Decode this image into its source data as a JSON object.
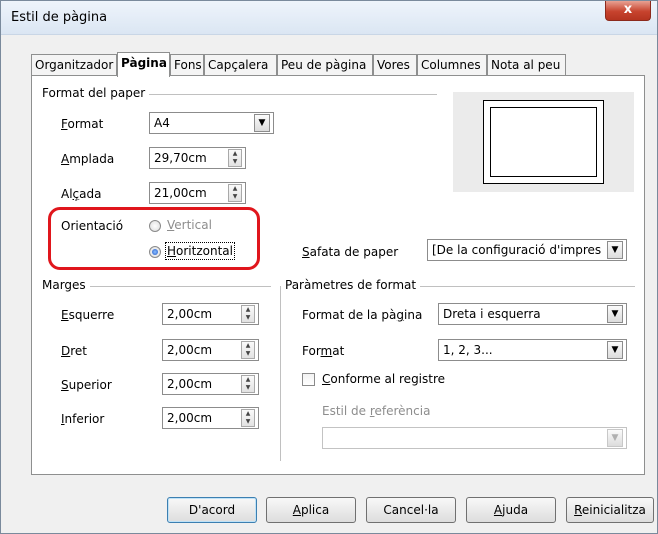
{
  "window": {
    "title": "Estil de pàgina",
    "close_glyph": "x"
  },
  "tabs": [
    {
      "label": "Organitzador",
      "active": false
    },
    {
      "label": "Pàgina",
      "active": true
    },
    {
      "label": "Fons",
      "active": false
    },
    {
      "label": "Capçalera",
      "active": false
    },
    {
      "label": "Peu de pàgina",
      "active": false
    },
    {
      "label": "Vores",
      "active": false
    },
    {
      "label": "Columnes",
      "active": false
    },
    {
      "label": "Nota al peu",
      "active": false
    }
  ],
  "paper": {
    "group_title": "Format del paper",
    "format": {
      "label_pre": "",
      "label_key": "F",
      "label_post": "ormat",
      "value": "A4"
    },
    "width": {
      "label_pre": "",
      "label_key": "A",
      "label_post": "mplada",
      "value": "29,70cm"
    },
    "height": {
      "label_pre": "Al",
      "label_key": "ç",
      "label_post": "ada",
      "value": "21,00cm"
    },
    "orientation": {
      "label": "Orientació",
      "vertical_pre": "",
      "vertical_key": "V",
      "vertical_post": "ertical",
      "horizontal_pre": "",
      "horizontal_key": "H",
      "horizontal_post": "oritzontal",
      "selected": "horizontal"
    },
    "tray": {
      "label_pre": "",
      "label_key": "S",
      "label_post": "afata de paper",
      "value": "[De la configuració d'impres"
    }
  },
  "margins": {
    "group_title": "Marges",
    "left": {
      "label_pre": "",
      "label_key": "E",
      "label_post": "squerre",
      "value": "2,00cm"
    },
    "right": {
      "label_pre": "",
      "label_key": "D",
      "label_post": "ret",
      "value": "2,00cm"
    },
    "top": {
      "label_pre": "",
      "label_key": "S",
      "label_post": "uperior",
      "value": "2,00cm"
    },
    "bottom": {
      "label_pre": "",
      "label_key": "I",
      "label_post": "nferior",
      "value": "2,00cm"
    }
  },
  "layout": {
    "group_title": "Paràmetres de format",
    "page_layout": {
      "label_pre": "Format de la pà",
      "label_key": "g",
      "label_post": "ina",
      "value": "Dreta i esquerra"
    },
    "numbering": {
      "label_pre": "For",
      "label_key": "m",
      "label_post": "at",
      "value": "1, 2, 3..."
    },
    "register": {
      "label_pre": "",
      "label_key": "C",
      "label_post": "onforme al registre",
      "checked": false
    },
    "ref_style": {
      "label_pre": "Estil de ",
      "label_key": "r",
      "label_post": "eferència",
      "value": ""
    }
  },
  "buttons": {
    "ok": {
      "label_pre": "D'acord",
      "label_key": "",
      "label_post": ""
    },
    "apply": {
      "label_pre": "",
      "label_key": "A",
      "label_post": "plica"
    },
    "cancel": {
      "label_pre": "Cancel·la",
      "label_key": "",
      "label_post": ""
    },
    "help": {
      "label_pre": "",
      "label_key": "A",
      "label_post": "juda"
    },
    "reset": {
      "label_pre": "",
      "label_key": "R",
      "label_post": "einicialitza"
    }
  },
  "colors": {
    "highlight": "#e0161c",
    "close_button": "#c7432e",
    "default_button_border": "#3c7fb1"
  },
  "icons": {
    "spin": "spin-up-down-icon",
    "dropdown": "chevron-down-icon",
    "close": "close-icon"
  }
}
